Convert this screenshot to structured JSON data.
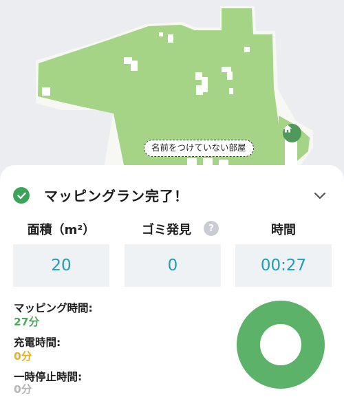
{
  "map": {
    "room_label": "名前をつけていない部屋",
    "home_icon": "home-icon"
  },
  "header": {
    "title": "マッピングラン完了！",
    "status_icon": "check-circle-icon",
    "collapse_icon": "chevron-down-icon"
  },
  "stats": [
    {
      "label": "面積（m²）",
      "value": "20"
    },
    {
      "label": "ゴミ発見",
      "value": "0",
      "help": "?"
    },
    {
      "label": "時間",
      "value": "00:27"
    }
  ],
  "details": [
    {
      "label": "マッピング時間:",
      "value": "27分",
      "color": "#4fa55a"
    },
    {
      "label": "充電時間:",
      "value": "0分",
      "color": "#e3b21f"
    },
    {
      "label": "一時停止時間:",
      "value": "0分",
      "color": "#b5b5b5"
    }
  ],
  "colors": {
    "map_floor": "#a6d486",
    "accent_green": "#3ea35a",
    "value_blue": "#1f9cb8",
    "donut": "#5db26a"
  }
}
